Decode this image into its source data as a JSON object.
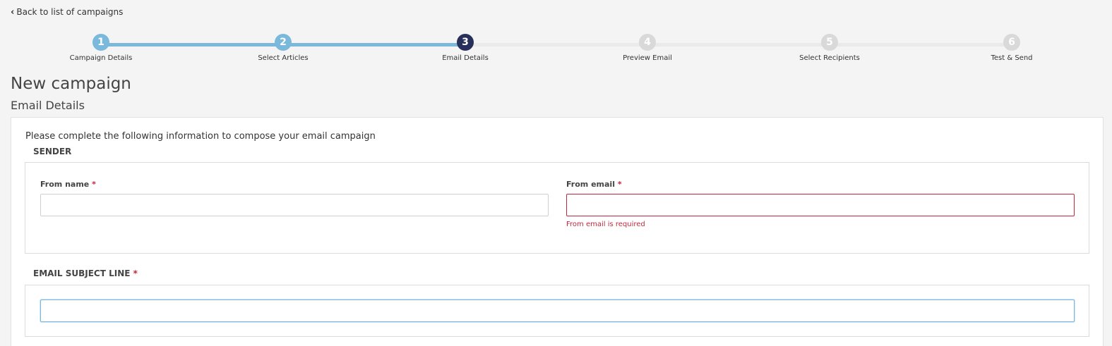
{
  "nav": {
    "back_label": "Back to list of campaigns"
  },
  "stepper": {
    "steps": [
      {
        "number": "1",
        "label": "Campaign Details",
        "state": "done"
      },
      {
        "number": "2",
        "label": "Select Articles",
        "state": "done"
      },
      {
        "number": "3",
        "label": "Email Details",
        "state": "active"
      },
      {
        "number": "4",
        "label": "Preview Email",
        "state": "todo"
      },
      {
        "number": "5",
        "label": "Select Recipients",
        "state": "todo"
      },
      {
        "number": "6",
        "label": "Test & Send",
        "state": "todo"
      }
    ]
  },
  "page": {
    "title": "New campaign",
    "section": "Email Details",
    "intro": "Please complete the following information to compose your email campaign"
  },
  "sender": {
    "heading": "SENDER",
    "from_name_label": "From name",
    "from_name_value": "",
    "from_email_label": "From email",
    "from_email_value": "",
    "from_email_error": "From email is required"
  },
  "subject": {
    "heading": "EMAIL SUBJECT LINE",
    "value": ""
  },
  "required_marker": "*",
  "colors": {
    "step_done": "#7ab8dc",
    "step_active": "#26305a",
    "step_todo": "#d9d9d9",
    "error": "#c2283b"
  }
}
